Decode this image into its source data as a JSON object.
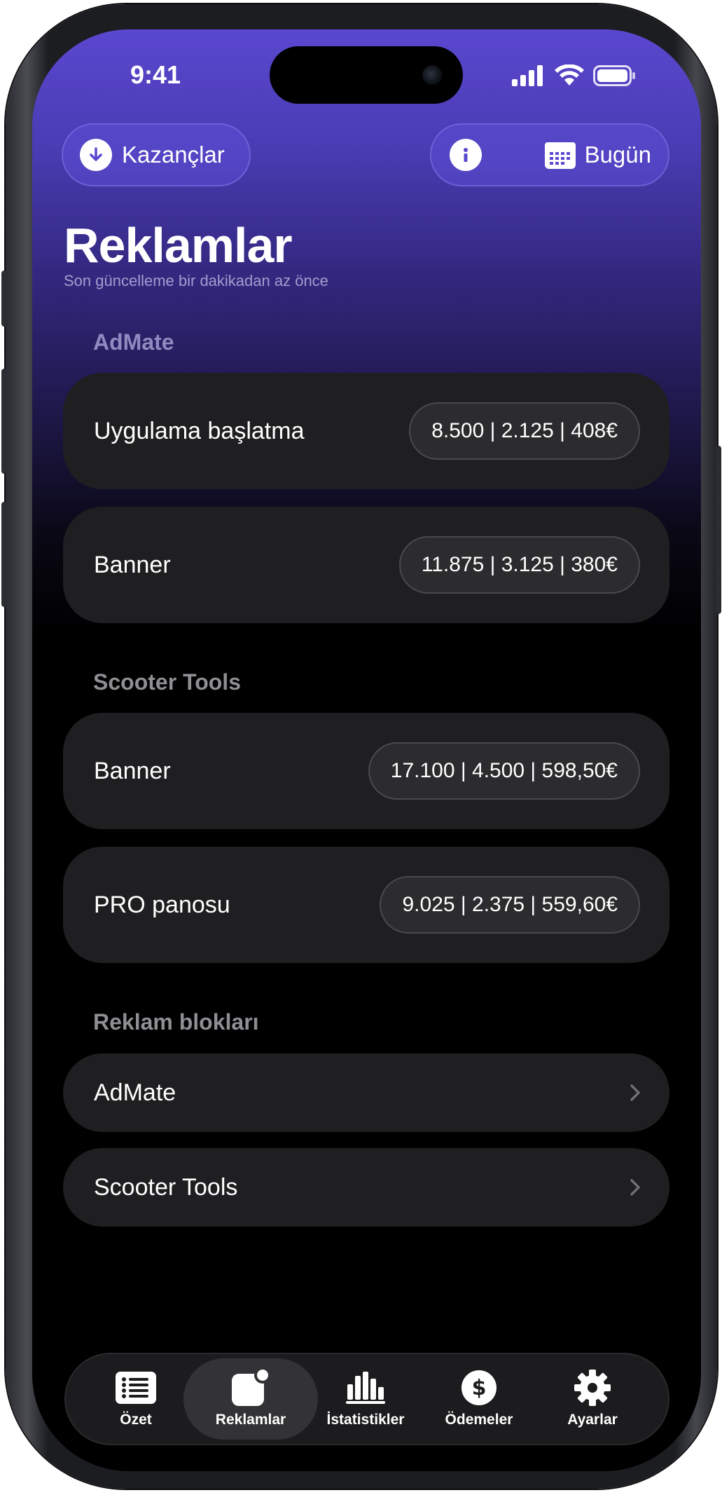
{
  "status_bar": {
    "time": "9:41"
  },
  "header": {
    "earnings_button": "Kazançlar",
    "info_icon": "info-icon",
    "date_button": "Bugün",
    "title": "Reklamlar",
    "subtitle": "Son güncelleme bir dakikadan az önce"
  },
  "sections": [
    {
      "title": "AdMate",
      "rows": [
        {
          "label": "Uygulama başlatma",
          "value": "8.500 | 2.125 | 408€"
        },
        {
          "label": "Banner",
          "value": "11.875 | 3.125 | 380€"
        }
      ]
    },
    {
      "title": "Scooter Tools",
      "rows": [
        {
          "label": "Banner",
          "value": "17.100 | 4.500 | 598,50€"
        },
        {
          "label": "PRO panosu",
          "value": "9.025 | 2.375 | 559,60€"
        }
      ]
    }
  ],
  "ad_blocks": {
    "title": "Reklam blokları",
    "items": [
      "AdMate",
      "Scooter Tools"
    ]
  },
  "tab_bar": {
    "active": "Reklamlar",
    "tabs": [
      {
        "label": "Özet",
        "icon": "list-icon"
      },
      {
        "label": "Reklamlar",
        "icon": "ads-badge-icon"
      },
      {
        "label": "İstatistikler",
        "icon": "bar-chart-icon"
      },
      {
        "label": "Ödemeler",
        "icon": "dollar-icon"
      },
      {
        "label": "Ayarlar",
        "icon": "gear-icon"
      }
    ]
  },
  "colors": {
    "gradient_top": "#5948cf",
    "card_bg": "#1f1f21",
    "pill_bg": "#2c2c2e"
  }
}
